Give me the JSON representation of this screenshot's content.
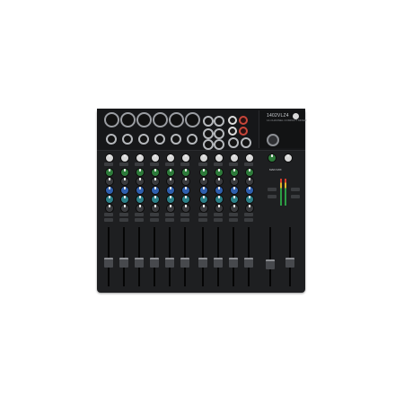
{
  "brand": {
    "model_label": "1402VLZ4",
    "subtitle": "14-CHANNEL COMPACT MIXER"
  },
  "master": {
    "label": "MAIN MIX"
  },
  "colors": {
    "chassis": "#1e1f21",
    "knob_green": "#2d7b3a",
    "knob_blue": "#2f5fae",
    "knob_teal": "#2b7f86",
    "rca_red": "#c8463a"
  }
}
